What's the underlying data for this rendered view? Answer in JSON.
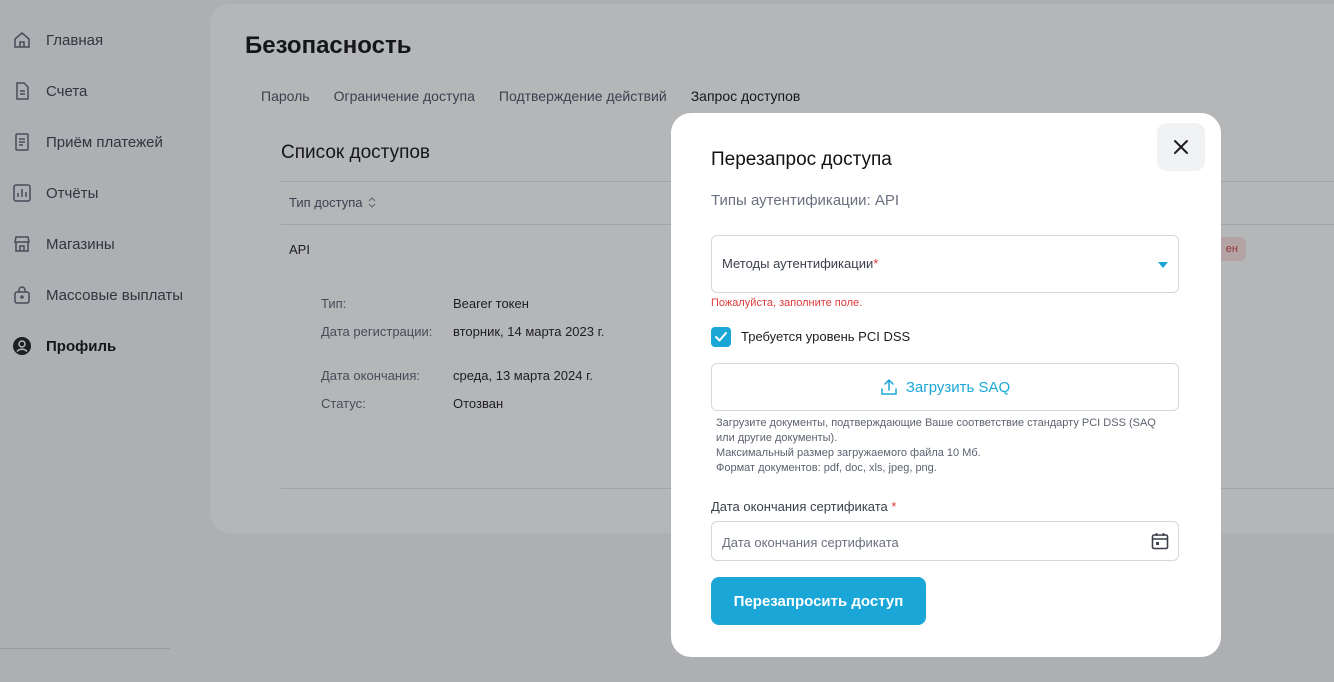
{
  "sidebar": {
    "items": [
      {
        "label": "Главная",
        "icon": "home-icon"
      },
      {
        "label": "Счета",
        "icon": "document-icon"
      },
      {
        "label": "Приём платежей",
        "icon": "receipt-icon"
      },
      {
        "label": "Отчёты",
        "icon": "chart-icon"
      },
      {
        "label": "Магазины",
        "icon": "store-icon"
      },
      {
        "label": "Массовые выплаты",
        "icon": "bag-icon"
      },
      {
        "label": "Профиль",
        "icon": "user-icon",
        "active": true
      }
    ]
  },
  "main": {
    "title": "Безопасность",
    "tabs": [
      {
        "label": "Пароль"
      },
      {
        "label": "Ограничение доступа"
      },
      {
        "label": "Подтверждение действий"
      },
      {
        "label": "Запрос доступов",
        "active": true
      }
    ],
    "section_title": "Список доступов",
    "table": {
      "column_header": "Тип доступа",
      "row": {
        "type": "API",
        "status_badge": "ен",
        "details": [
          {
            "label": "Тип:",
            "value": "Bearer токен"
          },
          {
            "label": "Дата регистрации:",
            "value": "вторник, 14 марта 2023 г."
          },
          {
            "label": "Дата окончания:",
            "value": "среда, 13 марта 2024 г."
          },
          {
            "label": "Статус:",
            "value": "Отозван"
          }
        ]
      }
    }
  },
  "modal": {
    "title": "Перезапрос доступа",
    "auth_types": "Типы аутентификации: API",
    "auth_methods_label": "Методы аутентификации",
    "required_mark": "*",
    "error": "Пожалуйста, заполните поле.",
    "pci_checkbox": {
      "label": "Требуется уровень PCI DSS",
      "checked": true
    },
    "upload_label": "Загрузить SAQ",
    "hint_lines": [
      "Загрузите документы, подтверждающие Ваше соответствие стандарту PCI DSS (SAQ или другие документы).",
      "Максимальный размер загружаемого файла 10 Мб.",
      "Формат документов: pdf, doc, xls, jpeg, png."
    ],
    "date_label": "Дата окончания сертификата",
    "date_placeholder": "Дата окончания сертификата",
    "submit_label": "Перезапросить доступ"
  },
  "colors": {
    "accent": "#1aa7d8",
    "error": "#e03b3b",
    "overlay": "rgba(30,32,38,0.33)"
  }
}
